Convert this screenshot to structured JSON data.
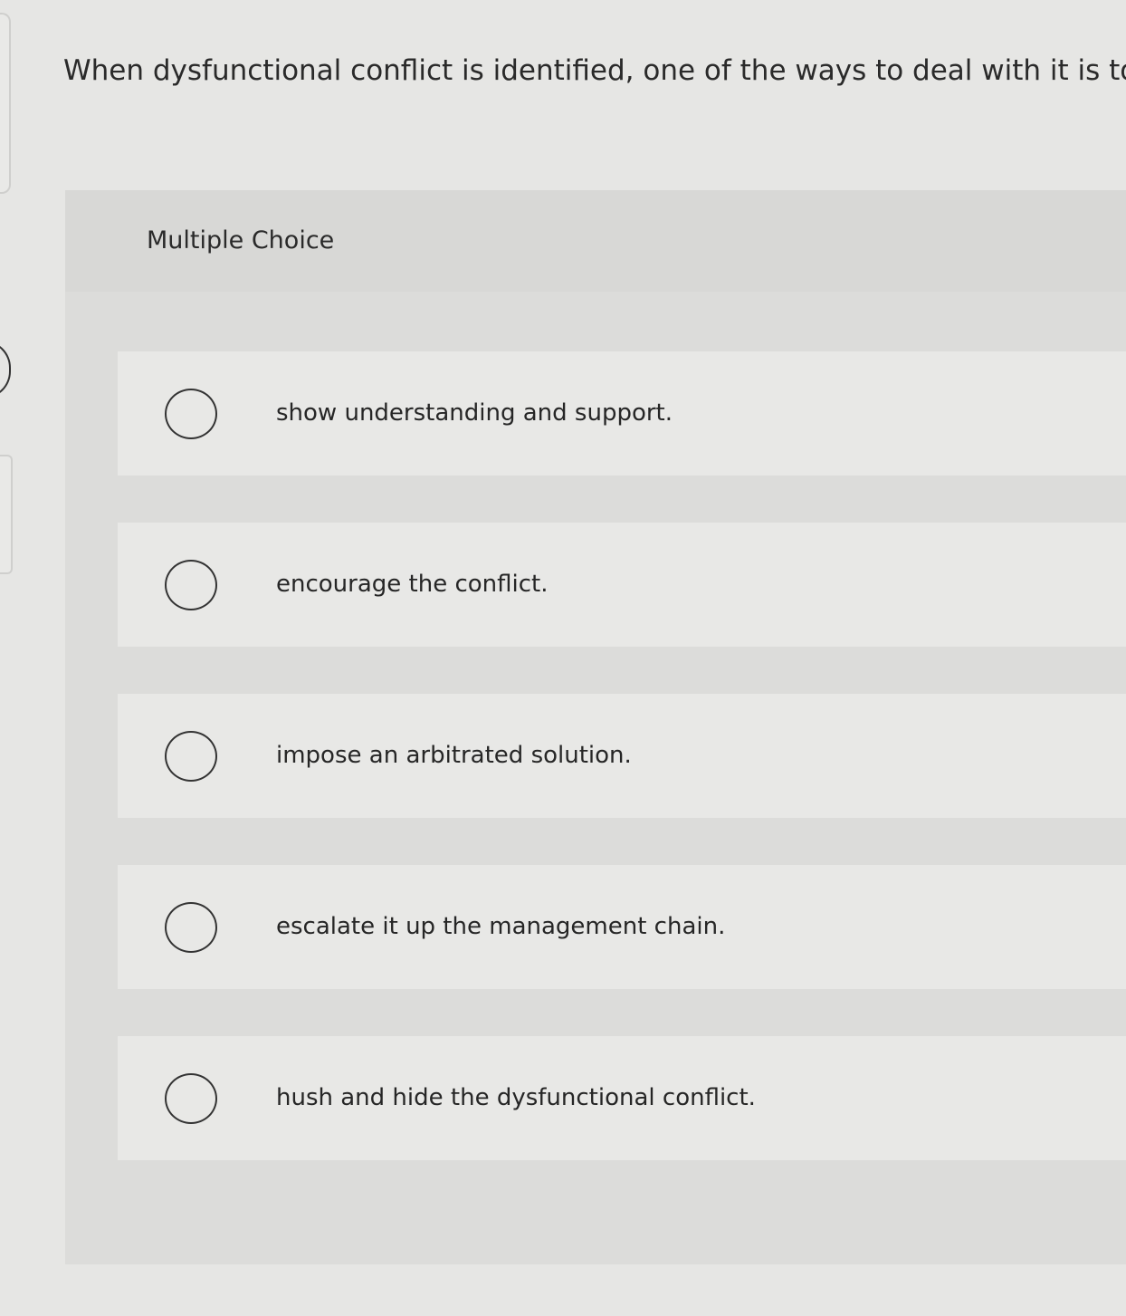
{
  "question": {
    "text": "When dysfunctional conflict is identified, one of the ways to deal with it is to"
  },
  "panel": {
    "label": "Multiple Choice"
  },
  "options": [
    {
      "label": "show understanding and support.",
      "selected": false
    },
    {
      "label": "encourage the conflict.",
      "selected": false
    },
    {
      "label": "impose an arbitrated solution.",
      "selected": false
    },
    {
      "label": "escalate it up the management chain.",
      "selected": false
    },
    {
      "label": "hush and hide the dysfunctional conflict.",
      "selected": false
    }
  ]
}
